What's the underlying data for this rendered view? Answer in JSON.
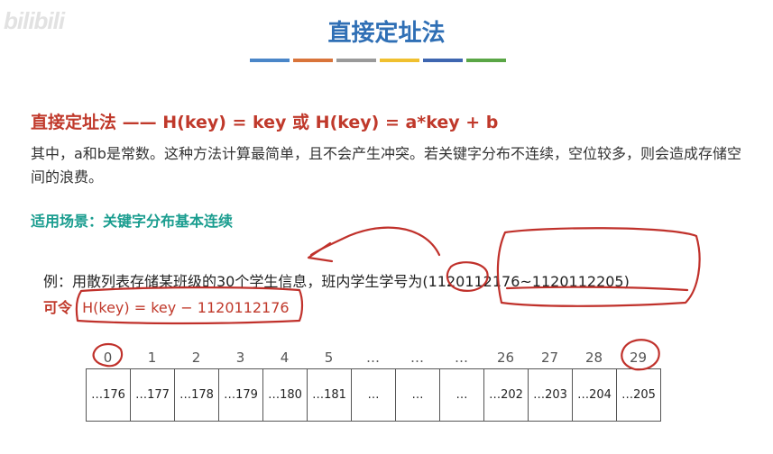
{
  "watermark": "bilibili",
  "title": "直接定址法",
  "accent_colors": [
    "#4a86c8",
    "#d9743a",
    "#9a9a9a",
    "#f0c02f",
    "#3e66b0",
    "#5aa646"
  ],
  "formula": "直接定址法 —— H(key) = key 或 H(key) = a*key + b",
  "description": "其中，a和b是常数。这种方法计算最简单，且不会产生冲突。若关键字分布不连续，空位较多，则会造成存储空间的浪费。",
  "scenario": "适用场景：关键字分布基本连续",
  "example": "例：用散列表存储某班级的30个学生信息，班内学生学号为(1120112176~1120112205)",
  "let_label": "可令",
  "let_formula": "H(key) = key − 1120112176",
  "table": {
    "indices": [
      "0",
      "1",
      "2",
      "3",
      "4",
      "5",
      "…",
      "…",
      "…",
      "26",
      "27",
      "28",
      "29"
    ],
    "cells": [
      "…176",
      "…177",
      "…178",
      "…179",
      "…180",
      "…181",
      "…",
      "…",
      "…",
      "…202",
      "…203",
      "…204",
      "…205"
    ]
  },
  "ink_color": "#c0312b"
}
